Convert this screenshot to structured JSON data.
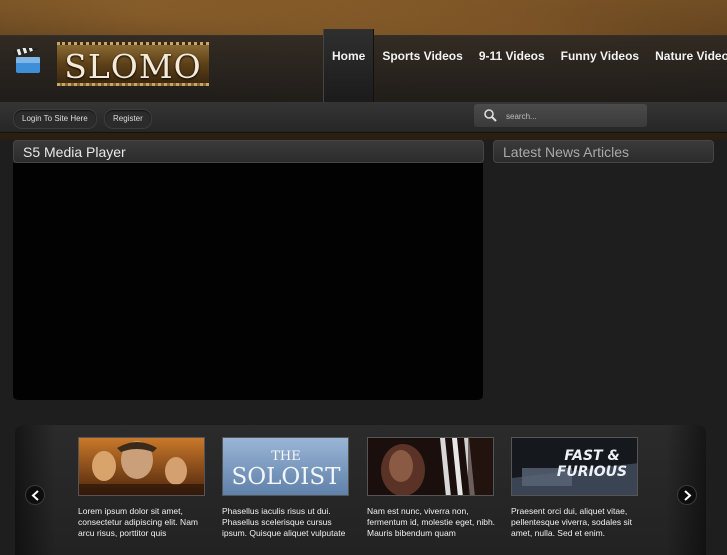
{
  "logo": {
    "text": "SLOMO"
  },
  "nav": [
    {
      "label": "Home",
      "active": true
    },
    {
      "label": "Sports Videos",
      "active": false
    },
    {
      "label": "9-11 Videos",
      "active": false
    },
    {
      "label": "Funny Videos",
      "active": false
    },
    {
      "label": "Nature Videos",
      "active": false
    }
  ],
  "subbar": {
    "login_label": "Login To Site Here",
    "register_label": "Register"
  },
  "search": {
    "placeholder": "search..."
  },
  "player": {
    "title": "S5 Media Player"
  },
  "news": {
    "title": "Latest News Articles"
  },
  "carousel": {
    "items": [
      {
        "caption": "Lorem ipsum dolor sit amet, consectetur adipiscing elit. Nam arcu risus, porttitor quis",
        "poster": "adventure-movie-poster"
      },
      {
        "caption": "Phasellus iaculis risus ut dui. Phasellus scelerisque cursus ipsum. Quisque aliquet vulputate",
        "poster_text": "THE SOLOIST"
      },
      {
        "caption": "Nam est nunc, viverra non, fermentum id, molestie eget, nibh. Mauris bibendum quam",
        "poster": "claws-movie-poster"
      },
      {
        "caption": "Praesent orci dui, aliquet vitae, pellentesque viverra, sodales sit amet, nulla. Sed et enim.",
        "poster_text": "FAST & FURIOUS"
      }
    ]
  },
  "colors": {
    "background": "#1e1e1e",
    "header_brown": "#6b4a22",
    "player": "#020202"
  }
}
